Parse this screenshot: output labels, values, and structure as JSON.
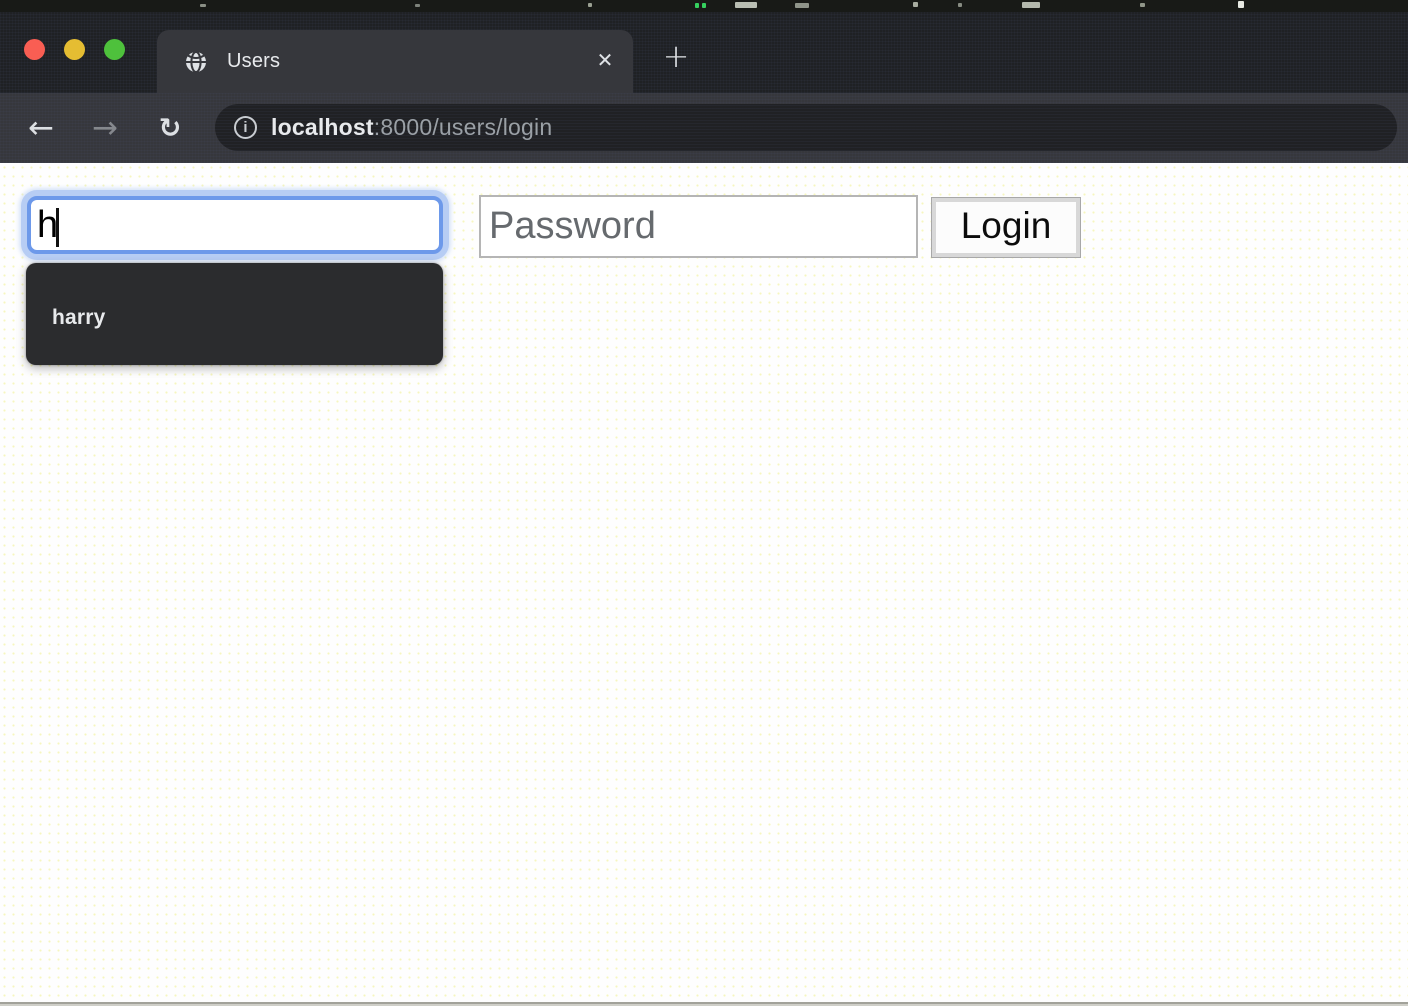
{
  "browser": {
    "tab_title": "Users",
    "address_bar": {
      "host": "localhost",
      "path_suffix": ":8000/users/login",
      "full_url": "localhost:8000/users/login"
    },
    "icons": {
      "close_tab": "✕",
      "new_tab": "+",
      "back": "←",
      "forward": "→",
      "reload": "↻",
      "info": "i",
      "globe": "globe-icon"
    },
    "traffic_lights": {
      "close": "#f95e53",
      "minimize": "#e5bd32",
      "zoom": "#4ec13c"
    }
  },
  "page": {
    "username_field": {
      "value": "h"
    },
    "autocomplete": {
      "items": [
        "harry"
      ]
    },
    "password_field": {
      "placeholder": "Password"
    },
    "login_button": {
      "label": "Login"
    }
  },
  "colors": {
    "frame": "#1f2124",
    "tab_active": "#36373c",
    "toolbar": "#36373c",
    "omnibox": "#202124",
    "url_primary": "#e8eaed",
    "url_secondary": "#9aa0a6",
    "focus_ring": "#6d99ea",
    "focus_glow": "#b7cdf4",
    "dropdown_bg": "#2b2c2e",
    "dropdown_text": "#e8eaec",
    "page_bg": "#fefefe"
  }
}
